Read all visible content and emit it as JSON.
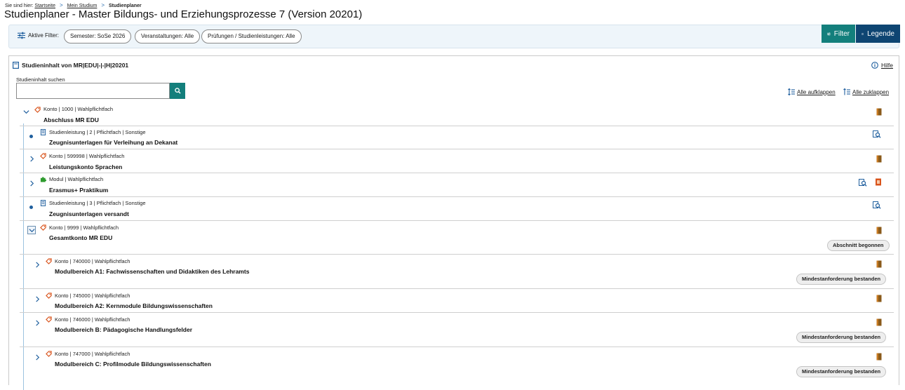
{
  "breadcrumb": {
    "prefix": "Sie sind hier:",
    "items": [
      "Startseite",
      "Mein Studium",
      "Studienplaner"
    ]
  },
  "page_title": "Studienplaner - Master Bildungs- und Erziehungsprozesse 7 (Version 20201)",
  "filter": {
    "label": "Aktive Filter:",
    "pills": [
      "Semester: SoSe 2026",
      "Veranstaltungen: Alle",
      "Prüfungen / Studienleistungen: Alle"
    ],
    "filter_button": "Filter",
    "legend_button": "Legende"
  },
  "panel": {
    "title": "Studieninhalt von MR|EDU|-|-|H|20201",
    "help": "Hilfe",
    "search_label": "Studieninhalt suchen",
    "search_value": "",
    "expand_all": "Alle aufklappen",
    "collapse_all": "Alle zuklappen"
  },
  "rows": [
    {
      "type": "Konto",
      "meta": "Konto  | 1000  | Wahlpflichtfach",
      "name": "Abschluss MR EDU",
      "status": ""
    },
    {
      "type": "Studienleistung",
      "meta": "Studienleistung  | 2  | Pflichtfach  | Sonstige",
      "name": "Zeugnisunterlagen für Verleihung an Dekanat",
      "status": ""
    },
    {
      "type": "Konto",
      "meta": "Konto  | 599998  | Wahlpflichtfach",
      "name": "Leistungskonto Sprachen",
      "status": ""
    },
    {
      "type": "Modul",
      "meta": "Modul  | Wahlpflichtfach",
      "name": "Erasmus+ Praktikum",
      "status": ""
    },
    {
      "type": "Studienleistung",
      "meta": "Studienleistung  | 3  | Pflichtfach  | Sonstige",
      "name": "Zeugnisunterlagen versandt",
      "status": ""
    },
    {
      "type": "Konto",
      "meta": "Konto  | 9999  | Wahlpflichtfach",
      "name": "Gesamtkonto MR EDU",
      "status": "Abschnitt begonnen"
    },
    {
      "type": "Konto",
      "meta": "Konto  | 740000  | Wahlpflichtfach",
      "name": "Modulbereich A1: Fachwissenschaften und Didaktiken des Lehramts",
      "status": "Mindestanforderung bestanden"
    },
    {
      "type": "Konto",
      "meta": "Konto  | 745000  | Wahlpflichtfach",
      "name": "Modulbereich A2: Kernmodule Bildungswissenschaften",
      "status": ""
    },
    {
      "type": "Konto",
      "meta": "Konto  | 746000  | Wahlpflichtfach",
      "name": "Modulbereich B: Pädagogische Handlungsfelder",
      "status": "Mindestanforderung bestanden"
    },
    {
      "type": "Konto",
      "meta": "Konto  | 747000  | Wahlpflichtfach",
      "name": "Modulbereich C: Profilmodule Bildungswissenschaften",
      "status": "Mindestanforderung bestanden"
    }
  ],
  "colors": {
    "teal": "#137f7c",
    "navy": "#0e4572",
    "link_blue": "#1f5f9e",
    "konto_red": "#d9541c",
    "modul_green": "#2e9b2e",
    "door_brown": "#8a5a1a"
  }
}
